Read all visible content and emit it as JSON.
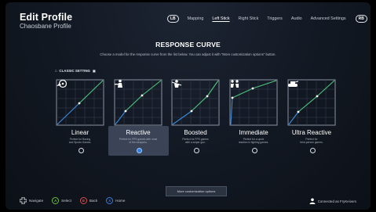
{
  "header": {
    "title": "Edit Profile",
    "subtitle": "Chaosbane Profile",
    "lb": "LB",
    "rb": "RB",
    "tabs": [
      {
        "label": "Mapping"
      },
      {
        "label": "Left Stick"
      },
      {
        "label": "Right Stick"
      },
      {
        "label": "Triggers"
      },
      {
        "label": "Audio"
      },
      {
        "label": "Advanced Settings"
      }
    ],
    "active_tab": "Left Stick"
  },
  "section": {
    "title": "RESPONSE CURVE",
    "description": "Choose a model for the response curve from the list below. You can adjust it with \"More customization options\" button."
  },
  "classic_setting": {
    "badge": "□",
    "label": "CLASSIC SETTING",
    "suffix": "▣"
  },
  "curves": [
    {
      "name": "Linear",
      "desc_lines": [
        "Perfect for Racing",
        "and Sports Games."
      ],
      "selected": false,
      "icon": "car-icon"
    },
    {
      "name": "Reactive",
      "desc_lines": [
        "Perfect for FPS games with most",
        "of the weapons."
      ],
      "selected": true,
      "icon": "shooter-icon"
    },
    {
      "name": "Boosted",
      "desc_lines": [
        "Perfect for FPS games",
        "with a sniper gun."
      ],
      "selected": false,
      "icon": "sniper-icon"
    },
    {
      "name": "Immediate",
      "desc_lines": [
        "Perfect for a quick",
        "reaction in fighting games."
      ],
      "selected": false,
      "icon": "fighting-icon"
    },
    {
      "name": "Ultra Reactive",
      "desc_lines": [
        "Perfect for",
        "third-person games."
      ],
      "selected": false,
      "icon": "tank-icon"
    }
  ],
  "customize_button": "More customization options",
  "footer": {
    "hints": [
      {
        "key": "+",
        "label": "Navigate",
        "color": "#ffffff"
      },
      {
        "key": "A",
        "label": "Select",
        "color": "#6ac043"
      },
      {
        "key": "B",
        "label": "Back",
        "color": "#e04a4a"
      },
      {
        "key": "X",
        "label": "Home",
        "color": "#3b7fe0"
      }
    ],
    "connection": "Connected as FryKeivers"
  },
  "colors": {
    "curve_green": "#4ec47c",
    "curve_blue": "#3a8be0",
    "selected": "#2f7fe0"
  }
}
